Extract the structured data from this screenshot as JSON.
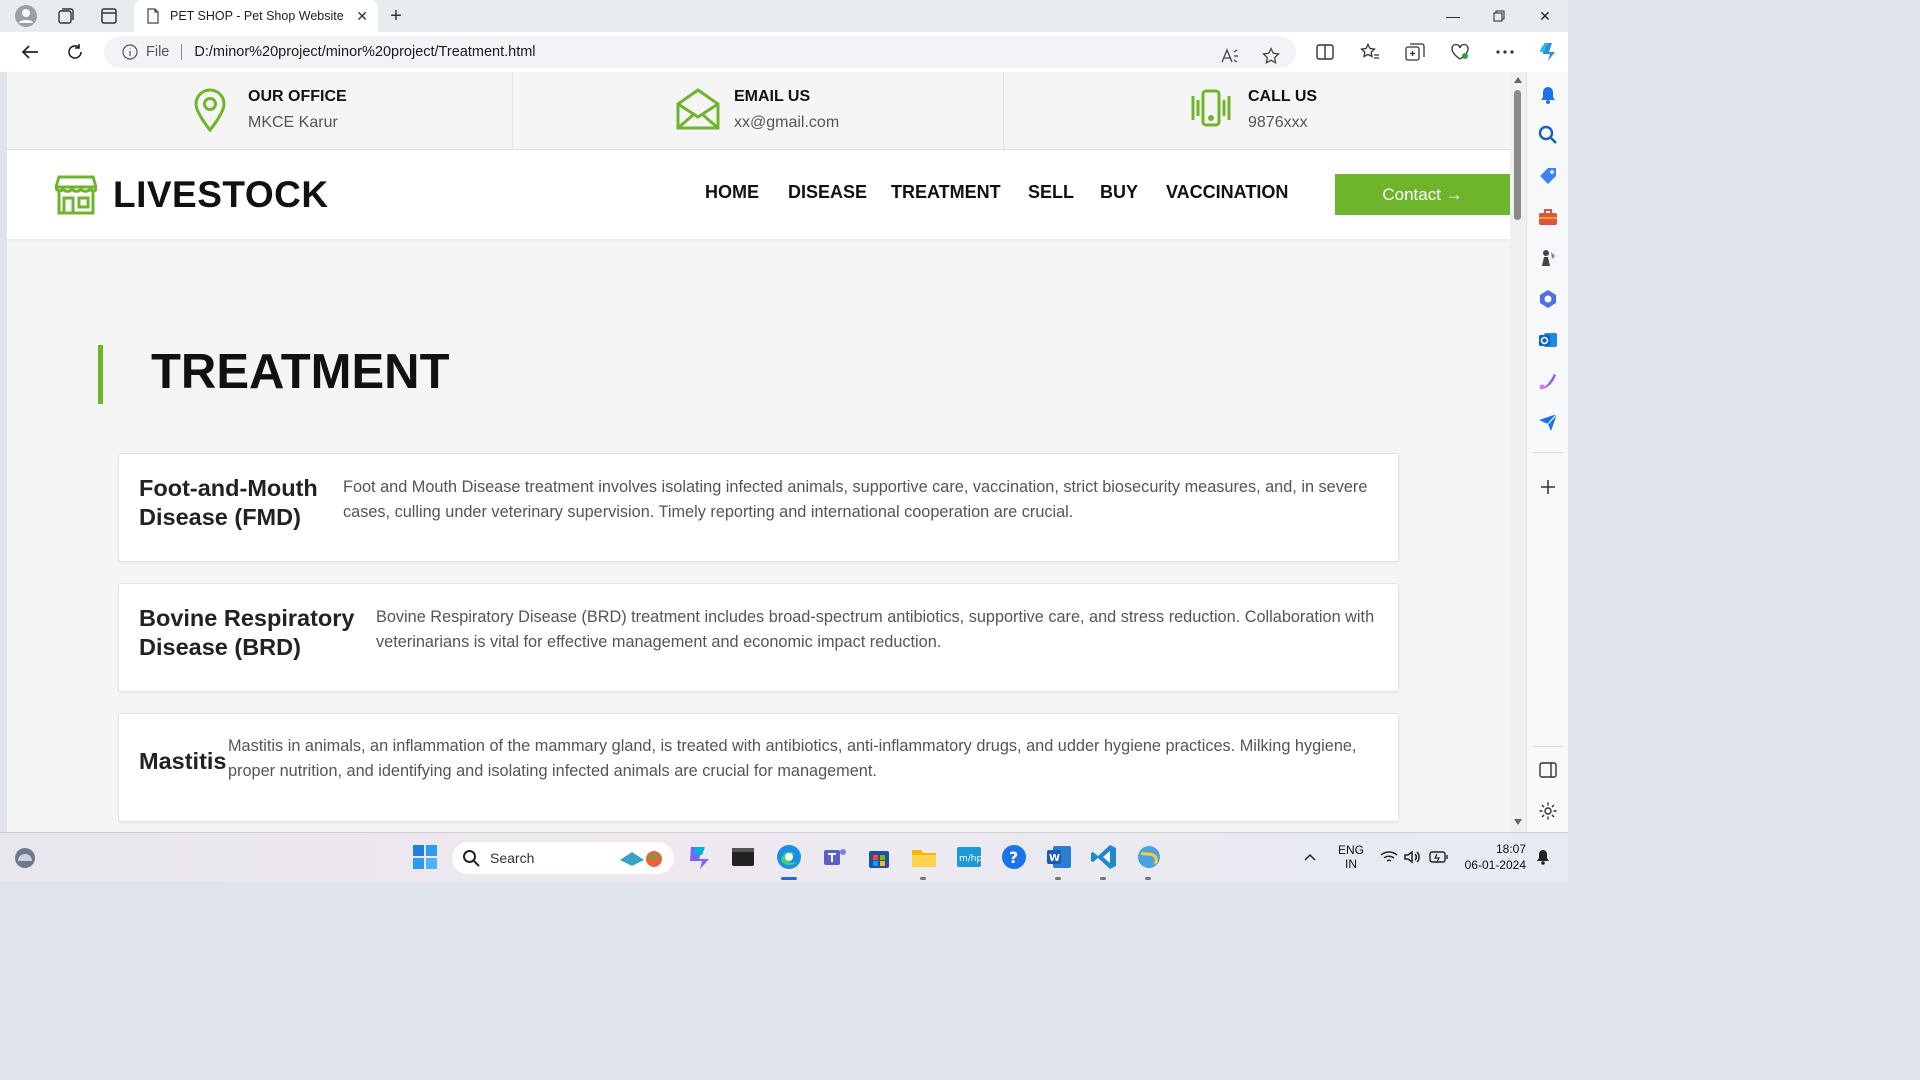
{
  "browser": {
    "tab_title": "PET SHOP - Pet Shop Website Te",
    "url_scheme": "File",
    "url": "D:/minor%20project/minor%20project/Treatment.html"
  },
  "topbar": {
    "office": {
      "label": "OUR OFFICE",
      "value": "MKCE Karur"
    },
    "email": {
      "label": "EMAIL US",
      "value": "xx@gmail.com"
    },
    "call": {
      "label": "CALL US",
      "value": "9876xxx"
    }
  },
  "site": {
    "logo": "LIVESTOCK",
    "menu": [
      "HOME",
      "DISEASE",
      "TREATMENT",
      "SELL",
      "BUY",
      "VACCINATION"
    ],
    "contact_label": "Contact →",
    "accent": "#6fb52c"
  },
  "heading": "TREATMENT",
  "treatments": [
    {
      "title_line1": "Foot-and-Mouth",
      "title_line2": "Disease (FMD)",
      "text_line1": "Foot and Mouth Disease treatment involves isolating infected animals, supportive care, vaccination, strict biosecurity measures, and, in severe",
      "text_line2": "cases, culling under veterinary supervision. Timely reporting and international cooperation are crucial."
    },
    {
      "title_line1": "Bovine Respiratory",
      "title_line2": "Disease (BRD)",
      "text_line1": "Bovine Respiratory Disease (BRD) treatment includes broad-spectrum antibiotics, supportive care, and stress reduction. Collaboration with",
      "text_line2": "veterinarians is vital for effective management and economic impact reduction."
    },
    {
      "title_line1": "Mastitis",
      "title_line2": "",
      "text_line1": "Mastitis in animals, an inflammation of the mammary gland, is treated with antibiotics, anti-inflammatory drugs, and udder hygiene practices. Milking hygiene,",
      "text_line2": "proper nutrition, and identifying and isolating infected animals are crucial for management."
    }
  ],
  "taskbar": {
    "search_placeholder": "Search",
    "lang_top": "ENG",
    "lang_bottom": "IN",
    "time": "18:07",
    "date": "06-01-2024"
  }
}
